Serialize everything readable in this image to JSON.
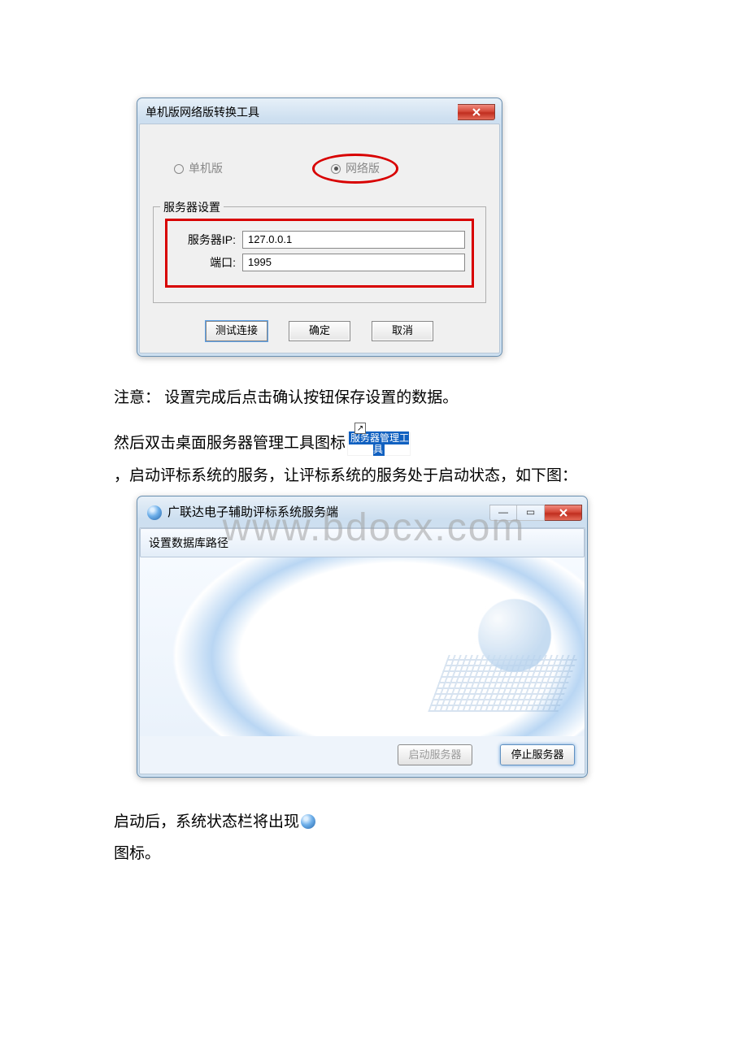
{
  "watermark": "www.bdocx.com",
  "dialog1": {
    "title": "单机版网络版转换工具",
    "radio_standalone": "单机版",
    "radio_network": "网络版",
    "group_title": "服务器设置",
    "server_ip_label": "服务器IP:",
    "server_ip_value": "127.0.0.1",
    "port_label": "端口:",
    "port_value": "1995",
    "btn_test": "测试连接",
    "btn_ok": "确定",
    "btn_cancel": "取消"
  },
  "text1": "注意：  设置完成后点击确认按钮保存设置的数据。",
  "text2a": "然后双击桌面服务器管理工具图标",
  "shortcut_label": "服务器管理工具",
  "text3": "，启动评标系统的服务，让评标系统的服务处于启动状态，如下图：",
  "win2": {
    "title": "广联达电子辅助评标系统服务端",
    "menu_item": "设置数据库路径",
    "btn_start": "启动服务器",
    "btn_stop": "停止服务器"
  },
  "text4": "启动后，系统状态栏将出现",
  "text5": "图标。"
}
